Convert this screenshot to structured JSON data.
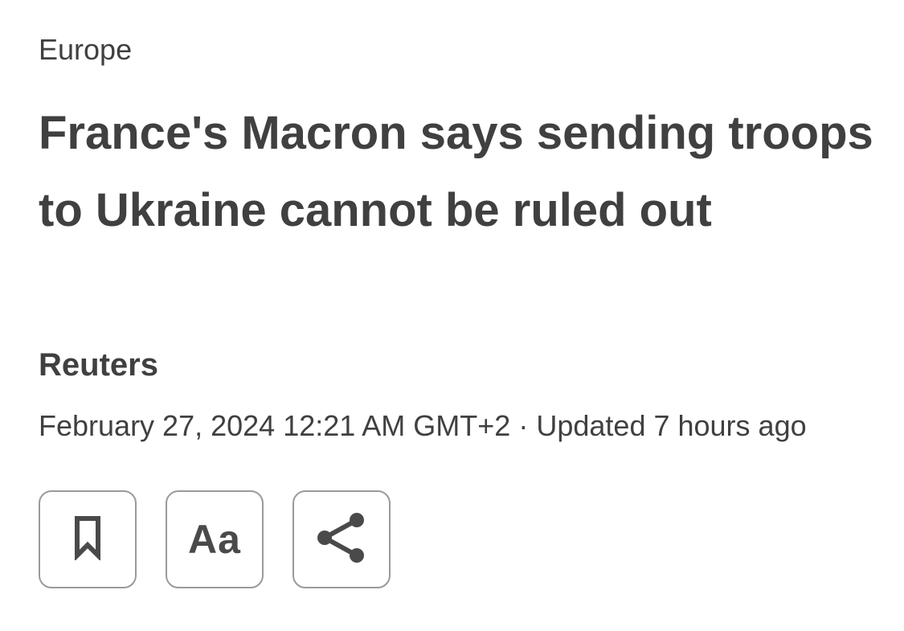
{
  "article": {
    "section": "Europe",
    "headline": "France's Macron says sending troops to Ukraine cannot be ruled out",
    "byline": "Reuters",
    "published": "February 27, 2024 12:21 AM GMT+2",
    "separator": "·",
    "updated": "Updated 7 hours ago"
  },
  "actions": {
    "bookmark_icon": "bookmark-icon",
    "text_size_label": "Aa",
    "share_icon": "share-icon"
  },
  "colors": {
    "text": "#404040",
    "button_border": "#9a9a9a",
    "icon": "#4a4a4a",
    "background": "#ffffff"
  }
}
